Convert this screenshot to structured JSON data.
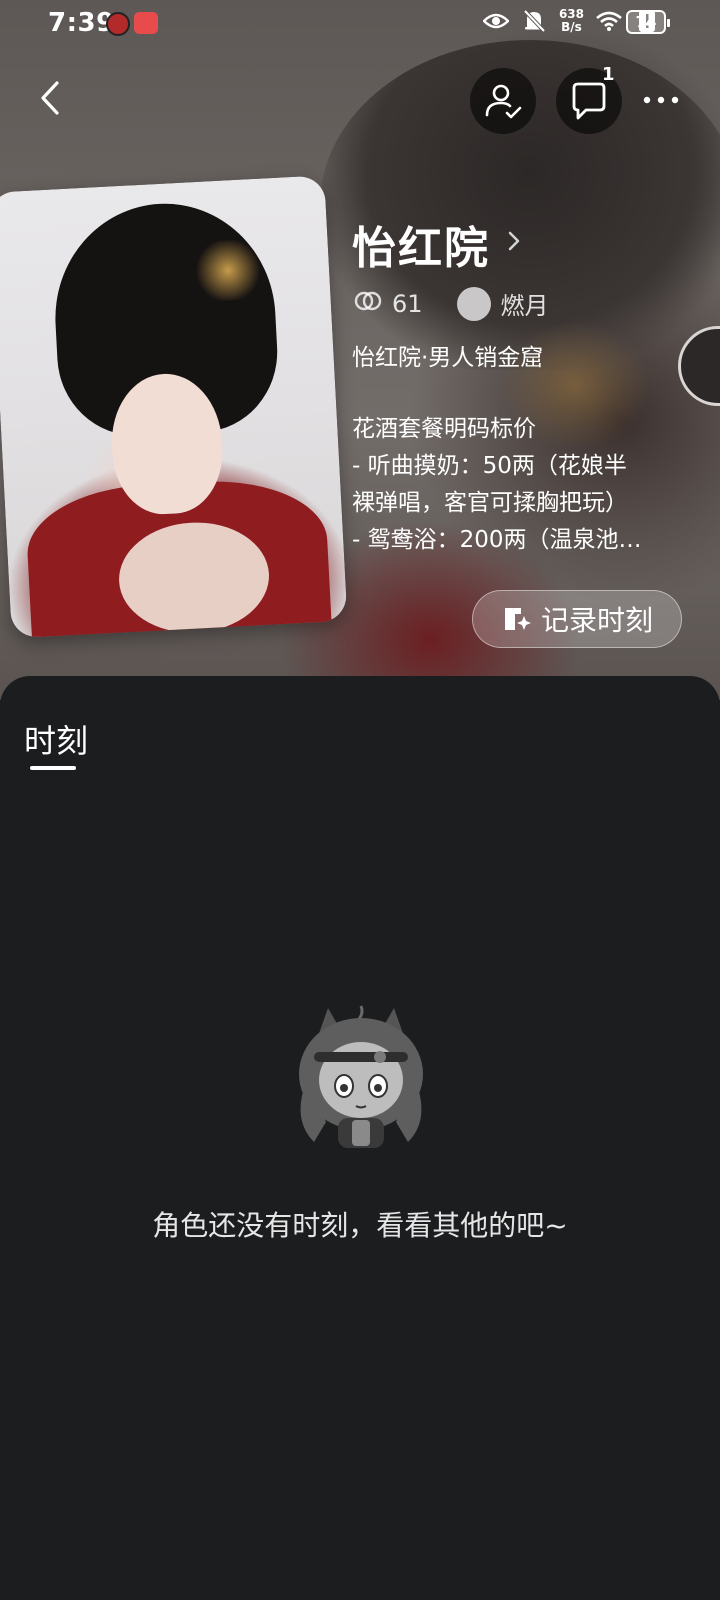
{
  "status_bar": {
    "time": "7:39",
    "network_speed_value": "638",
    "network_speed_unit": "B/s",
    "battery": "74"
  },
  "nav": {
    "chat_count": "1"
  },
  "profile": {
    "name": "怡红院",
    "stat_count": "61",
    "creator_name": "燃月",
    "tagline": "怡红院·男人销金窟",
    "bio_lines": [
      "花酒套餐明码标价",
      "- 听曲摸奶：50两（花娘半",
      "裸弹唱，客官可揉胸把玩）",
      "- 鸳鸯浴：200两（温泉池…"
    ],
    "record_button_label": "记录时刻"
  },
  "tabs": [
    {
      "label": "时刻",
      "active": true
    }
  ],
  "empty_state": {
    "message": "角色还没有时刻，看看其他的吧~"
  },
  "colors": {
    "sheet_background": "#1c1d1f",
    "text_primary": "#ffffff"
  }
}
